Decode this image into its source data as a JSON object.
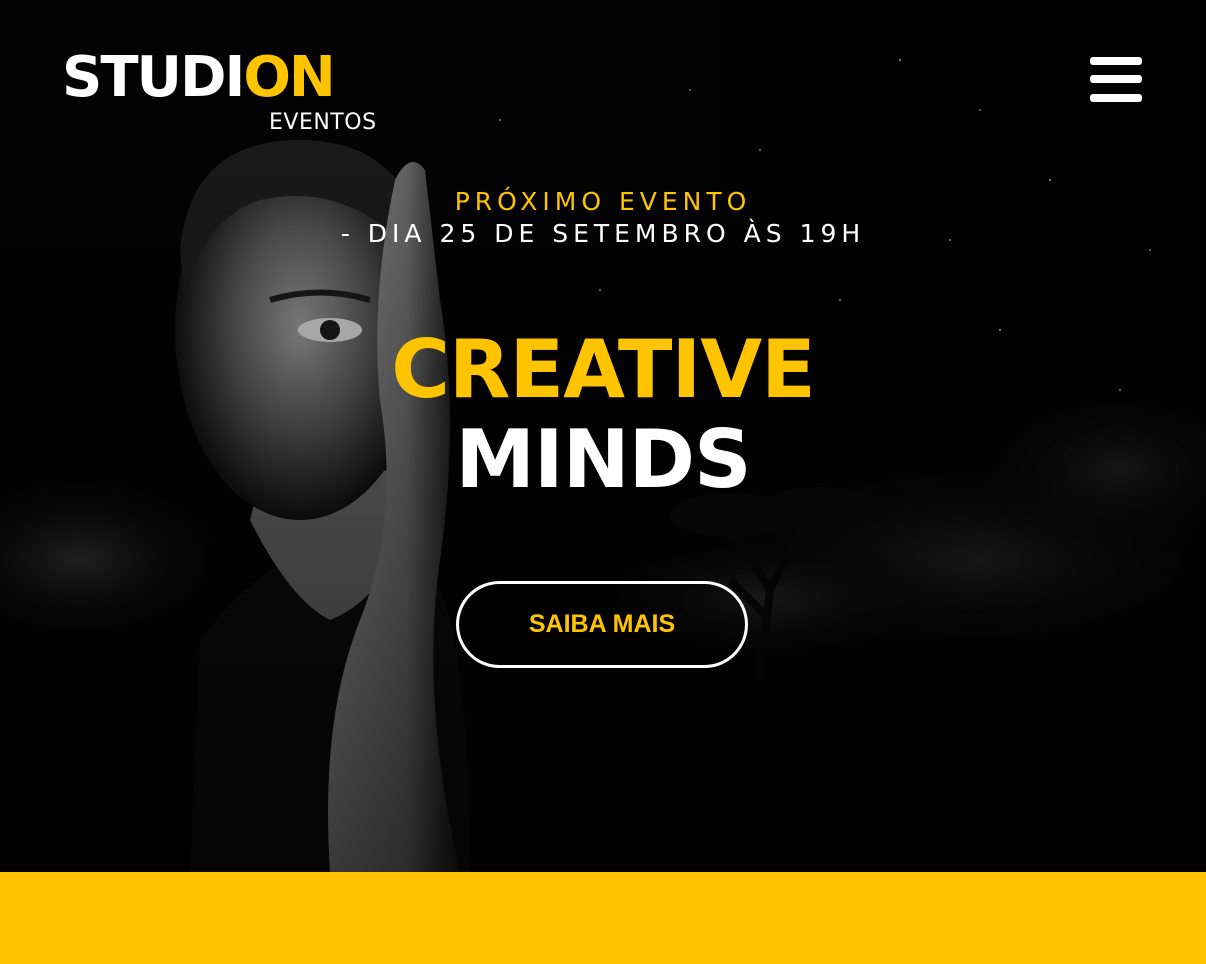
{
  "header": {
    "logo": {
      "part1": "STUDI",
      "part2": "ON",
      "subtitle": "EVENTOS"
    },
    "menu_icon": "hamburger-menu-icon"
  },
  "hero": {
    "event_label": "PRÓXIMO EVENTO",
    "event_date": "- DIA 25 DE SETEMBRO ÀS 19H",
    "title_line1": "CREATIVE",
    "title_line2": "MINDS",
    "cta_label": "SAIBA MAIS"
  },
  "colors": {
    "accent": "#ffc400",
    "background": "#000000",
    "text": "#ffffff"
  }
}
